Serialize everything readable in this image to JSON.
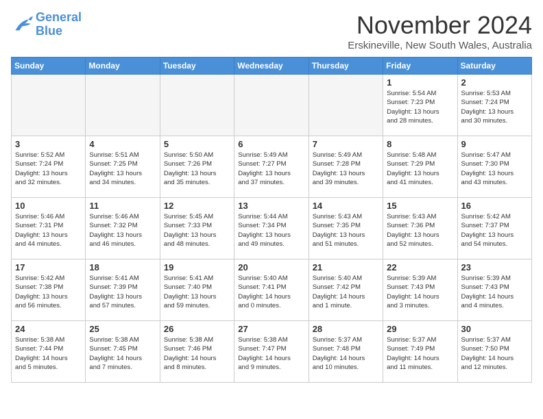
{
  "logo": {
    "line1": "General",
    "line2": "Blue"
  },
  "title": "November 2024",
  "subtitle": "Erskineville, New South Wales, Australia",
  "days_of_week": [
    "Sunday",
    "Monday",
    "Tuesday",
    "Wednesday",
    "Thursday",
    "Friday",
    "Saturday"
  ],
  "weeks": [
    [
      {
        "num": "",
        "info": ""
      },
      {
        "num": "",
        "info": ""
      },
      {
        "num": "",
        "info": ""
      },
      {
        "num": "",
        "info": ""
      },
      {
        "num": "",
        "info": ""
      },
      {
        "num": "1",
        "info": "Sunrise: 5:54 AM\nSunset: 7:23 PM\nDaylight: 13 hours\nand 28 minutes."
      },
      {
        "num": "2",
        "info": "Sunrise: 5:53 AM\nSunset: 7:24 PM\nDaylight: 13 hours\nand 30 minutes."
      }
    ],
    [
      {
        "num": "3",
        "info": "Sunrise: 5:52 AM\nSunset: 7:24 PM\nDaylight: 13 hours\nand 32 minutes."
      },
      {
        "num": "4",
        "info": "Sunrise: 5:51 AM\nSunset: 7:25 PM\nDaylight: 13 hours\nand 34 minutes."
      },
      {
        "num": "5",
        "info": "Sunrise: 5:50 AM\nSunset: 7:26 PM\nDaylight: 13 hours\nand 35 minutes."
      },
      {
        "num": "6",
        "info": "Sunrise: 5:49 AM\nSunset: 7:27 PM\nDaylight: 13 hours\nand 37 minutes."
      },
      {
        "num": "7",
        "info": "Sunrise: 5:49 AM\nSunset: 7:28 PM\nDaylight: 13 hours\nand 39 minutes."
      },
      {
        "num": "8",
        "info": "Sunrise: 5:48 AM\nSunset: 7:29 PM\nDaylight: 13 hours\nand 41 minutes."
      },
      {
        "num": "9",
        "info": "Sunrise: 5:47 AM\nSunset: 7:30 PM\nDaylight: 13 hours\nand 43 minutes."
      }
    ],
    [
      {
        "num": "10",
        "info": "Sunrise: 5:46 AM\nSunset: 7:31 PM\nDaylight: 13 hours\nand 44 minutes."
      },
      {
        "num": "11",
        "info": "Sunrise: 5:46 AM\nSunset: 7:32 PM\nDaylight: 13 hours\nand 46 minutes."
      },
      {
        "num": "12",
        "info": "Sunrise: 5:45 AM\nSunset: 7:33 PM\nDaylight: 13 hours\nand 48 minutes."
      },
      {
        "num": "13",
        "info": "Sunrise: 5:44 AM\nSunset: 7:34 PM\nDaylight: 13 hours\nand 49 minutes."
      },
      {
        "num": "14",
        "info": "Sunrise: 5:43 AM\nSunset: 7:35 PM\nDaylight: 13 hours\nand 51 minutes."
      },
      {
        "num": "15",
        "info": "Sunrise: 5:43 AM\nSunset: 7:36 PM\nDaylight: 13 hours\nand 52 minutes."
      },
      {
        "num": "16",
        "info": "Sunrise: 5:42 AM\nSunset: 7:37 PM\nDaylight: 13 hours\nand 54 minutes."
      }
    ],
    [
      {
        "num": "17",
        "info": "Sunrise: 5:42 AM\nSunset: 7:38 PM\nDaylight: 13 hours\nand 56 minutes."
      },
      {
        "num": "18",
        "info": "Sunrise: 5:41 AM\nSunset: 7:39 PM\nDaylight: 13 hours\nand 57 minutes."
      },
      {
        "num": "19",
        "info": "Sunrise: 5:41 AM\nSunset: 7:40 PM\nDaylight: 13 hours\nand 59 minutes."
      },
      {
        "num": "20",
        "info": "Sunrise: 5:40 AM\nSunset: 7:41 PM\nDaylight: 14 hours\nand 0 minutes."
      },
      {
        "num": "21",
        "info": "Sunrise: 5:40 AM\nSunset: 7:42 PM\nDaylight: 14 hours\nand 1 minute."
      },
      {
        "num": "22",
        "info": "Sunrise: 5:39 AM\nSunset: 7:43 PM\nDaylight: 14 hours\nand 3 minutes."
      },
      {
        "num": "23",
        "info": "Sunrise: 5:39 AM\nSunset: 7:43 PM\nDaylight: 14 hours\nand 4 minutes."
      }
    ],
    [
      {
        "num": "24",
        "info": "Sunrise: 5:38 AM\nSunset: 7:44 PM\nDaylight: 14 hours\nand 5 minutes."
      },
      {
        "num": "25",
        "info": "Sunrise: 5:38 AM\nSunset: 7:45 PM\nDaylight: 14 hours\nand 7 minutes."
      },
      {
        "num": "26",
        "info": "Sunrise: 5:38 AM\nSunset: 7:46 PM\nDaylight: 14 hours\nand 8 minutes."
      },
      {
        "num": "27",
        "info": "Sunrise: 5:38 AM\nSunset: 7:47 PM\nDaylight: 14 hours\nand 9 minutes."
      },
      {
        "num": "28",
        "info": "Sunrise: 5:37 AM\nSunset: 7:48 PM\nDaylight: 14 hours\nand 10 minutes."
      },
      {
        "num": "29",
        "info": "Sunrise: 5:37 AM\nSunset: 7:49 PM\nDaylight: 14 hours\nand 11 minutes."
      },
      {
        "num": "30",
        "info": "Sunrise: 5:37 AM\nSunset: 7:50 PM\nDaylight: 14 hours\nand 12 minutes."
      }
    ]
  ]
}
